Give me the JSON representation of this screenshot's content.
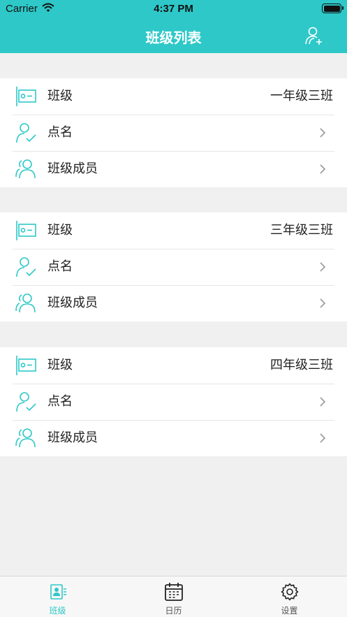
{
  "status_bar": {
    "carrier": "Carrier",
    "time": "4:37 PM"
  },
  "nav": {
    "title": "班级列表",
    "add_icon": "add-user-icon"
  },
  "colors": {
    "accent": "#2ec8c8",
    "background": "#f0f0f0",
    "separator": "#e6e6e6"
  },
  "groups": [
    {
      "class_label": "班级",
      "class_value": "一年级三班",
      "rollcall_label": "点名",
      "members_label": "班级成员"
    },
    {
      "class_label": "班级",
      "class_value": "三年级三班",
      "rollcall_label": "点名",
      "members_label": "班级成员"
    },
    {
      "class_label": "班级",
      "class_value": "四年级三班",
      "rollcall_label": "点名",
      "members_label": "班级成员"
    }
  ],
  "tabs": [
    {
      "label": "班级",
      "icon": "class-card-icon",
      "active": true
    },
    {
      "label": "日历",
      "icon": "calendar-icon",
      "active": false
    },
    {
      "label": "设置",
      "icon": "gear-icon",
      "active": false
    }
  ]
}
